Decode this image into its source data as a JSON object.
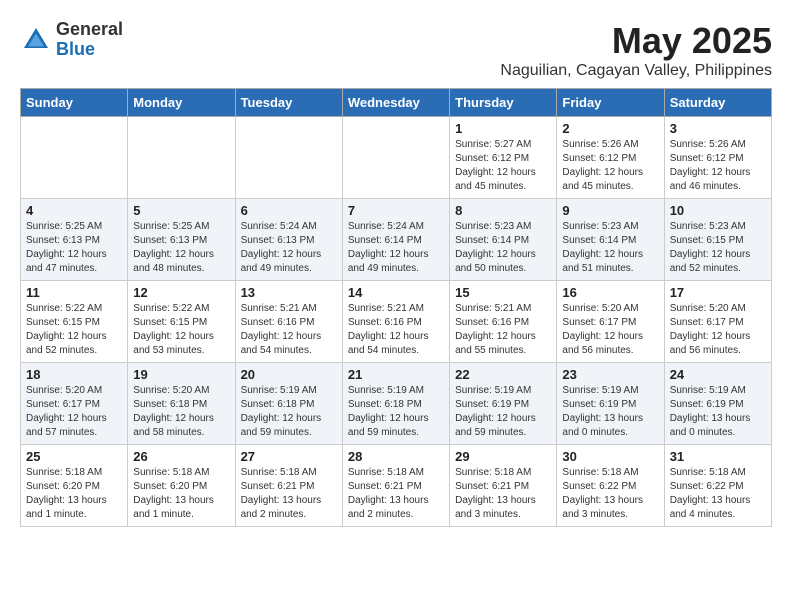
{
  "logo": {
    "general": "General",
    "blue": "Blue"
  },
  "title": {
    "month_year": "May 2025",
    "location": "Naguilian, Cagayan Valley, Philippines"
  },
  "headers": [
    "Sunday",
    "Monday",
    "Tuesday",
    "Wednesday",
    "Thursday",
    "Friday",
    "Saturday"
  ],
  "weeks": [
    [
      {
        "day": "",
        "info": ""
      },
      {
        "day": "",
        "info": ""
      },
      {
        "day": "",
        "info": ""
      },
      {
        "day": "",
        "info": ""
      },
      {
        "day": "1",
        "info": "Sunrise: 5:27 AM\nSunset: 6:12 PM\nDaylight: 12 hours\nand 45 minutes."
      },
      {
        "day": "2",
        "info": "Sunrise: 5:26 AM\nSunset: 6:12 PM\nDaylight: 12 hours\nand 45 minutes."
      },
      {
        "day": "3",
        "info": "Sunrise: 5:26 AM\nSunset: 6:12 PM\nDaylight: 12 hours\nand 46 minutes."
      }
    ],
    [
      {
        "day": "4",
        "info": "Sunrise: 5:25 AM\nSunset: 6:13 PM\nDaylight: 12 hours\nand 47 minutes."
      },
      {
        "day": "5",
        "info": "Sunrise: 5:25 AM\nSunset: 6:13 PM\nDaylight: 12 hours\nand 48 minutes."
      },
      {
        "day": "6",
        "info": "Sunrise: 5:24 AM\nSunset: 6:13 PM\nDaylight: 12 hours\nand 49 minutes."
      },
      {
        "day": "7",
        "info": "Sunrise: 5:24 AM\nSunset: 6:14 PM\nDaylight: 12 hours\nand 49 minutes."
      },
      {
        "day": "8",
        "info": "Sunrise: 5:23 AM\nSunset: 6:14 PM\nDaylight: 12 hours\nand 50 minutes."
      },
      {
        "day": "9",
        "info": "Sunrise: 5:23 AM\nSunset: 6:14 PM\nDaylight: 12 hours\nand 51 minutes."
      },
      {
        "day": "10",
        "info": "Sunrise: 5:23 AM\nSunset: 6:15 PM\nDaylight: 12 hours\nand 52 minutes."
      }
    ],
    [
      {
        "day": "11",
        "info": "Sunrise: 5:22 AM\nSunset: 6:15 PM\nDaylight: 12 hours\nand 52 minutes."
      },
      {
        "day": "12",
        "info": "Sunrise: 5:22 AM\nSunset: 6:15 PM\nDaylight: 12 hours\nand 53 minutes."
      },
      {
        "day": "13",
        "info": "Sunrise: 5:21 AM\nSunset: 6:16 PM\nDaylight: 12 hours\nand 54 minutes."
      },
      {
        "day": "14",
        "info": "Sunrise: 5:21 AM\nSunset: 6:16 PM\nDaylight: 12 hours\nand 54 minutes."
      },
      {
        "day": "15",
        "info": "Sunrise: 5:21 AM\nSunset: 6:16 PM\nDaylight: 12 hours\nand 55 minutes."
      },
      {
        "day": "16",
        "info": "Sunrise: 5:20 AM\nSunset: 6:17 PM\nDaylight: 12 hours\nand 56 minutes."
      },
      {
        "day": "17",
        "info": "Sunrise: 5:20 AM\nSunset: 6:17 PM\nDaylight: 12 hours\nand 56 minutes."
      }
    ],
    [
      {
        "day": "18",
        "info": "Sunrise: 5:20 AM\nSunset: 6:17 PM\nDaylight: 12 hours\nand 57 minutes."
      },
      {
        "day": "19",
        "info": "Sunrise: 5:20 AM\nSunset: 6:18 PM\nDaylight: 12 hours\nand 58 minutes."
      },
      {
        "day": "20",
        "info": "Sunrise: 5:19 AM\nSunset: 6:18 PM\nDaylight: 12 hours\nand 59 minutes."
      },
      {
        "day": "21",
        "info": "Sunrise: 5:19 AM\nSunset: 6:18 PM\nDaylight: 12 hours\nand 59 minutes."
      },
      {
        "day": "22",
        "info": "Sunrise: 5:19 AM\nSunset: 6:19 PM\nDaylight: 12 hours\nand 59 minutes."
      },
      {
        "day": "23",
        "info": "Sunrise: 5:19 AM\nSunset: 6:19 PM\nDaylight: 13 hours\nand 0 minutes."
      },
      {
        "day": "24",
        "info": "Sunrise: 5:19 AM\nSunset: 6:19 PM\nDaylight: 13 hours\nand 0 minutes."
      }
    ],
    [
      {
        "day": "25",
        "info": "Sunrise: 5:18 AM\nSunset: 6:20 PM\nDaylight: 13 hours\nand 1 minute."
      },
      {
        "day": "26",
        "info": "Sunrise: 5:18 AM\nSunset: 6:20 PM\nDaylight: 13 hours\nand 1 minute."
      },
      {
        "day": "27",
        "info": "Sunrise: 5:18 AM\nSunset: 6:21 PM\nDaylight: 13 hours\nand 2 minutes."
      },
      {
        "day": "28",
        "info": "Sunrise: 5:18 AM\nSunset: 6:21 PM\nDaylight: 13 hours\nand 2 minutes."
      },
      {
        "day": "29",
        "info": "Sunrise: 5:18 AM\nSunset: 6:21 PM\nDaylight: 13 hours\nand 3 minutes."
      },
      {
        "day": "30",
        "info": "Sunrise: 5:18 AM\nSunset: 6:22 PM\nDaylight: 13 hours\nand 3 minutes."
      },
      {
        "day": "31",
        "info": "Sunrise: 5:18 AM\nSunset: 6:22 PM\nDaylight: 13 hours\nand 4 minutes."
      }
    ]
  ]
}
